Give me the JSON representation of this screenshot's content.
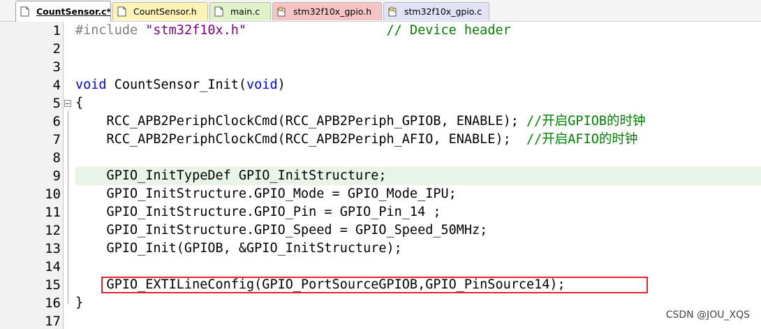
{
  "tabs": [
    {
      "label": "CountSensor.c*",
      "icon": "c-source-file-icon",
      "active": true
    },
    {
      "label": "CountSensor.h",
      "icon": "header-file-icon",
      "active": false
    },
    {
      "label": "main.c",
      "icon": "c-source-file-icon",
      "active": false
    },
    {
      "label": "stm32f10x_gpio.h",
      "icon": "library-header-file-icon",
      "active": false
    },
    {
      "label": "stm32f10x_gpio.c",
      "icon": "library-source-file-icon",
      "active": false
    }
  ],
  "editor": {
    "current_line": 9,
    "lines": [
      {
        "n": "1",
        "tokens": [
          [
            "pp",
            "#include "
          ],
          [
            "str",
            "\"stm32f10x.h\""
          ],
          [
            "pl",
            "                  "
          ],
          [
            "cmt",
            "// Device header"
          ]
        ]
      },
      {
        "n": "2",
        "tokens": []
      },
      {
        "n": "3",
        "tokens": []
      },
      {
        "n": "4",
        "tokens": [
          [
            "kw",
            "void"
          ],
          [
            "pl",
            " CountSensor_Init("
          ],
          [
            "kw",
            "void"
          ],
          [
            "pl",
            ")"
          ]
        ]
      },
      {
        "n": "5",
        "tokens": [
          [
            "pl",
            "{"
          ]
        ]
      },
      {
        "n": "6",
        "tokens": [
          [
            "pl",
            "    RCC_APB2PeriphClockCmd(RCC_APB2Periph_GPIOB, ENABLE); "
          ],
          [
            "cmt",
            "//开启GPIOB的时钟"
          ]
        ]
      },
      {
        "n": "7",
        "tokens": [
          [
            "pl",
            "    RCC_APB2PeriphClockCmd(RCC_APB2Periph_AFIO, ENABLE);  "
          ],
          [
            "cmt",
            "//开启AFIO的时钟"
          ]
        ]
      },
      {
        "n": "8",
        "tokens": []
      },
      {
        "n": "9",
        "tokens": [
          [
            "pl",
            "    GPIO_InitTypeDef GPIO_InitStructure;"
          ]
        ]
      },
      {
        "n": "10",
        "tokens": [
          [
            "pl",
            "    GPIO_InitStructure.GPIO_Mode = GPIO_Mode_IPU;"
          ]
        ]
      },
      {
        "n": "11",
        "tokens": [
          [
            "pl",
            "    GPIO_InitStructure.GPIO_Pin = GPIO_Pin_14 ;"
          ]
        ]
      },
      {
        "n": "12",
        "tokens": [
          [
            "pl",
            "    GPIO_InitStructure.GPIO_Speed = GPIO_Speed_50MHz;"
          ]
        ]
      },
      {
        "n": "13",
        "tokens": [
          [
            "pl",
            "    GPIO_Init(GPIOB, &GPIO_InitStructure);"
          ]
        ]
      },
      {
        "n": "14",
        "tokens": []
      },
      {
        "n": "15",
        "tokens": [
          [
            "pl",
            "    GPIO_EXTILineConfig(GPIO_PortSourceGPIOB,GPIO_PinSource14);"
          ]
        ]
      },
      {
        "n": "16",
        "tokens": [
          [
            "pl",
            "}"
          ]
        ]
      },
      {
        "n": "17",
        "tokens": []
      }
    ]
  },
  "watermark": "CSDN @JOU_XQS",
  "colors": {
    "keyword": "#0000ff",
    "comment": "#008000",
    "string": "#800080",
    "preprocessor": "#808080",
    "highlight_box": "#e0262a",
    "active_tab_fill": "#ffffff",
    "tab_yellow": "#fdf3b4",
    "tab_green": "#dff2c8",
    "tab_red": "#f6c4c4",
    "tab_lavender": "#e2e2f6"
  }
}
